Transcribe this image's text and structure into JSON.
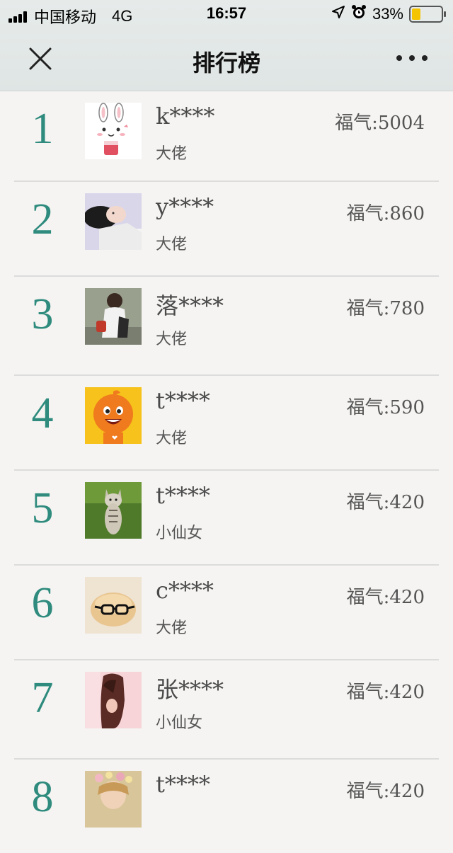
{
  "status_bar": {
    "carrier": "中国移动",
    "network": "4G",
    "time": "16:57",
    "battery": "33%"
  },
  "nav": {
    "title": "排行榜"
  },
  "colors": {
    "rank": "#2e8b7d",
    "battery_fill": "#f5c400"
  },
  "ranking": [
    {
      "rank": "1",
      "name": "k****",
      "tag": "大佬",
      "score": "福气:5004",
      "avatar": "rabbit-avatar"
    },
    {
      "rank": "2",
      "name": "y****",
      "tag": "大佬",
      "score": "福气:860",
      "avatar": "girl-avatar"
    },
    {
      "rank": "3",
      "name": "落****",
      "tag": "大佬",
      "score": "福气:780",
      "avatar": "person-back-avatar"
    },
    {
      "rank": "4",
      "name": "t****",
      "tag": "大佬",
      "score": "福气:590",
      "avatar": "orange-mascot-avatar"
    },
    {
      "rank": "5",
      "name": "t****",
      "tag": "小仙女",
      "score": "福气:420",
      "avatar": "cat-avatar"
    },
    {
      "rank": "6",
      "name": "c****",
      "tag": "大佬",
      "score": "福气:420",
      "avatar": "hamster-glasses-avatar"
    },
    {
      "rank": "7",
      "name": "张****",
      "tag": "小仙女",
      "score": "福气:420",
      "avatar": "woman-avatar"
    },
    {
      "rank": "8",
      "name": "t****",
      "tag": "",
      "score": "福气:420",
      "avatar": "girl-flowers-avatar"
    }
  ]
}
